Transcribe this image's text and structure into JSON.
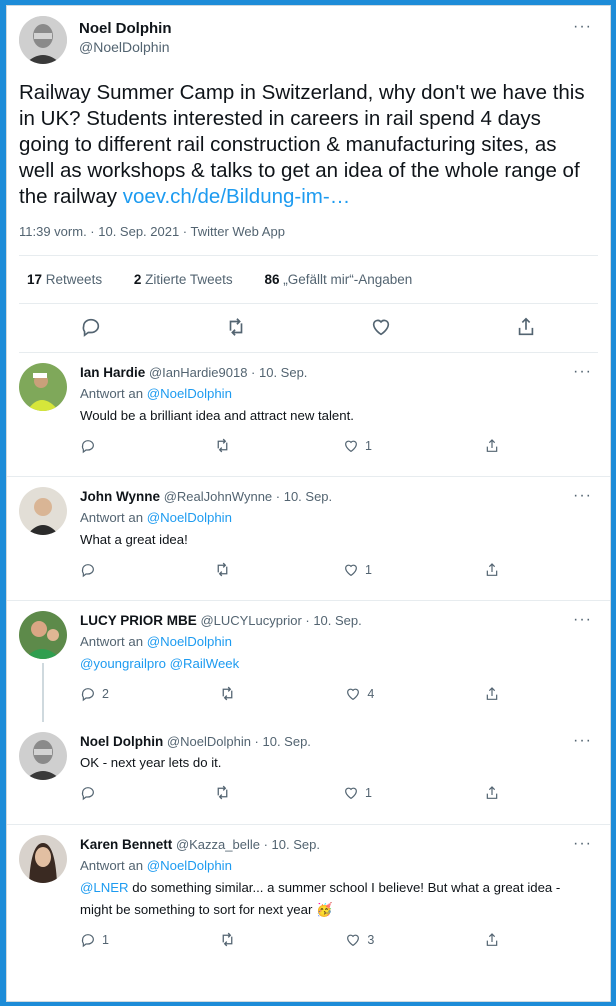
{
  "main_tweet": {
    "author_name": "Noel Dolphin",
    "author_handle": "@NoelDolphin",
    "more": "···",
    "text": "Railway Summer Camp in Switzerland, why don't we have this in UK? Students interested in careers in rail spend 4 days going to different rail construction & manufacturing sites, as well as workshops & talks to get an idea of the whole range of the railway",
    "link": "voev.ch/de/Bildung-im-…",
    "meta": "11:39 vorm. · 10. Sep. 2021 · Twitter Web App",
    "retweets_count": "17",
    "retweets_label": "Retweets",
    "quotes_count": "2",
    "quotes_label": "Zitierte Tweets",
    "likes_count": "86",
    "likes_label": "„Gefällt mir“-Angaben"
  },
  "replies": [
    {
      "name": "Ian Hardie",
      "handle": "@IanHardie9018 · 10. Sep.",
      "to_label": "Antwort an",
      "to": "@NoelDolphin",
      "text": "Would be a brilliant idea and attract new talent.",
      "mentions": "",
      "reply_count": "",
      "like_count": "1"
    },
    {
      "name": "John Wynne",
      "handle": "@RealJohnWynne · 10. Sep.",
      "to_label": "Antwort an",
      "to": "@NoelDolphin",
      "text": "What a great idea!",
      "mentions": "",
      "reply_count": "",
      "like_count": "1"
    },
    {
      "name": "LUCY PRIOR MBE",
      "handle": "@LUCYLucyprior · 10. Sep.",
      "to_label": "Antwort an",
      "to": "@NoelDolphin",
      "text": "",
      "mentions": "@youngrailpro @RailWeek",
      "reply_count": "2",
      "like_count": "4"
    },
    {
      "name": "Noel Dolphin",
      "handle": "@NoelDolphin · 10. Sep.",
      "to_label": "",
      "to": "",
      "text": "OK - next year lets do it.",
      "mentions": "",
      "reply_count": "",
      "like_count": "1"
    },
    {
      "name": "Karen Bennett",
      "handle": "@Kazza_belle · 10. Sep.",
      "to_label": "Antwort an",
      "to": "@NoelDolphin",
      "mention_lead": "@LNER",
      "text": "do something similar... a summer school I believe! But what a great idea - might be something to sort for next year 🥳",
      "reply_count": "1",
      "like_count": "3"
    }
  ],
  "colors": {
    "accent": "#1d9bf0",
    "frame": "#1d8cd8",
    "muted": "#536471"
  }
}
